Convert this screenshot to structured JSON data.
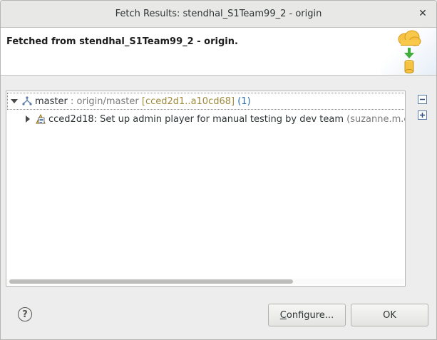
{
  "window": {
    "title": "Fetch Results: stendhal_S1Team99_2 - origin",
    "close_glyph": "✕"
  },
  "banner": {
    "message": "Fetched from stendhal_S1Team99_2 - origin.",
    "icon": "fetch-cloud-to-repository-icon"
  },
  "tree": {
    "rows": [
      {
        "expander": "expanded",
        "icon": "branch-icon",
        "name": "master",
        "separator": " : ",
        "remote": "origin/master",
        "range": "[cced2d1..a10cd68]",
        "count": "(1)"
      },
      {
        "expander": "collapsed",
        "icon": "commit-icon",
        "label": "cced2d18: Set up admin player for manual testing by dev team",
        "author": "(suzanne.m.en"
      }
    ]
  },
  "side_buttons": {
    "collapse_all": "collapse-all-icon",
    "expand_all": "expand-all-icon"
  },
  "footer": {
    "help_glyph": "?",
    "configure_prefix": "",
    "configure_mnemonic": "C",
    "configure_rest": "onfigure...",
    "ok_label": "OK"
  },
  "colors": {
    "accent_blue": "#2c6ea6",
    "range_gold": "#a08a3c",
    "dim_grey": "#7a7a7a"
  }
}
